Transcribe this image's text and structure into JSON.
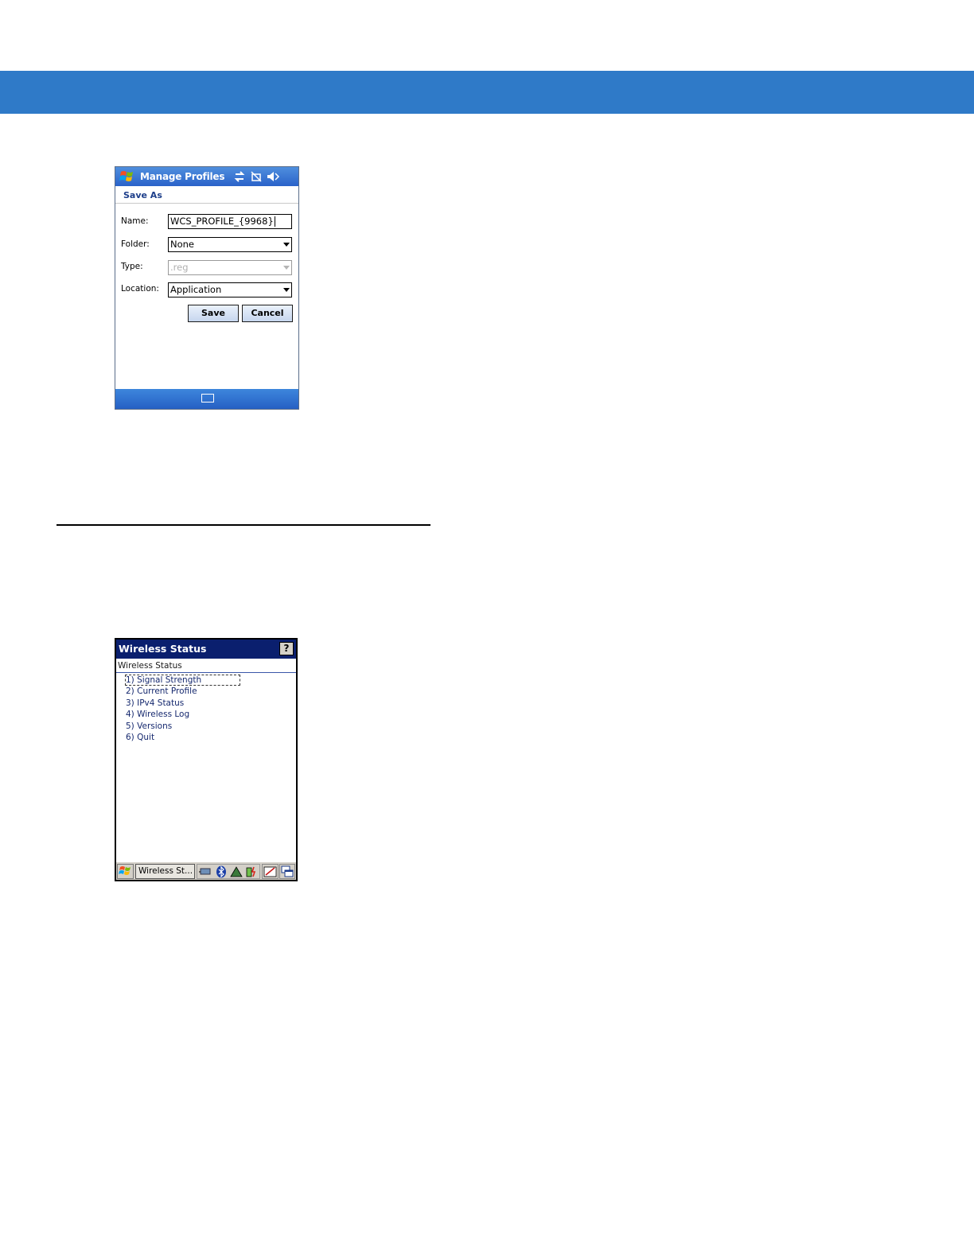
{
  "colors": {
    "header_band": "#2f7ac8",
    "wm_title": "#2a62c9",
    "ce_title": "#0a1f6e"
  },
  "manage_profiles": {
    "title": "Manage Profiles",
    "subtitle": "Save As",
    "name_label": "Name:",
    "name_value": "WCS_PROFILE_{9968}",
    "folder_label": "Folder:",
    "folder_value": "None",
    "type_label": "Type:",
    "type_value": ".reg",
    "location_label": "Location:",
    "location_value": "Application",
    "save_label": "Save",
    "cancel_label": "Cancel",
    "icons": [
      "windows-flag-icon",
      "connectivity-icon",
      "no-phone-icon",
      "speaker-icon",
      "keyboard-icon"
    ]
  },
  "wireless_status": {
    "title": "Wireless Status",
    "help_label": "?",
    "header": "Wireless Status",
    "items": [
      {
        "label": "1) Signal Strength"
      },
      {
        "label": "2) Current Profile"
      },
      {
        "label": "3) IPv4 Status"
      },
      {
        "label": "4) Wireless Log"
      },
      {
        "label": "5) Versions"
      },
      {
        "label": "6) Quit"
      }
    ],
    "taskbar_label": "Wireless St...",
    "icons": [
      "start-icon",
      "network-icon",
      "bluetooth-icon",
      "signal-icon",
      "battery-icon",
      "pen-icon",
      "windows-icon"
    ]
  }
}
